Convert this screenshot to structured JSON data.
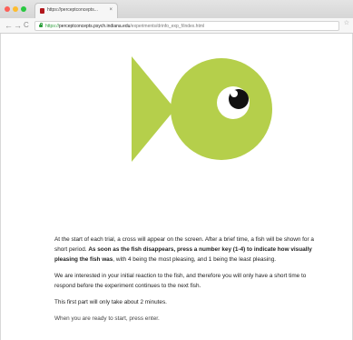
{
  "browser": {
    "tab": {
      "title": "https://perceptconcepts...",
      "close_glyph": "×"
    },
    "toolbar": {
      "back_glyph": "←",
      "forward_glyph": "→",
      "reload_glyph": "C"
    },
    "address_bar": {
      "scheme": "https://",
      "host": "perceptconcepts.psych.indiana.edu",
      "path": "/experiments/drinfo_exp_f/index.html",
      "star_glyph": "☆"
    }
  },
  "page": {
    "stimulus": {
      "icon": "fish-icon",
      "body_color": "#b5cf4b",
      "eye_white": "#ffffff",
      "pupil_color": "#111111"
    },
    "instructions": {
      "p1_before": "At the start of each trial, a cross will appear on the screen. After a brief time, a fish will be shown for a short period. ",
      "p1_bold": "As soon as the fish disappears, press a number key (1-4) to indicate how visually pleasing the fish was",
      "p1_after": ", with 4 being the most pleasing, and 1 being the least pleasing.",
      "p2": "We are interested in your initial reaction to the fish, and therefore you will only have a short time to respond before the experiment continues to the next fish.",
      "p3": "This first part will only take about 2 minutes.",
      "p4_partial": "When you are ready to start, press enter."
    }
  }
}
